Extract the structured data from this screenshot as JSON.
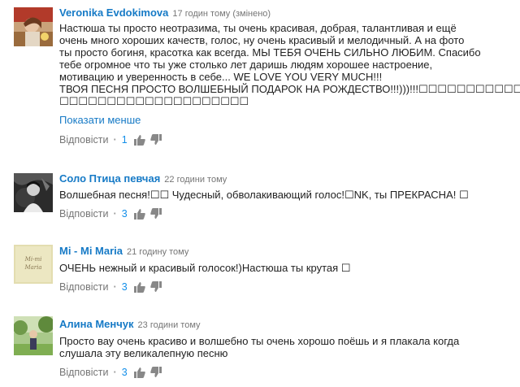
{
  "comments": [
    {
      "author": "Veronika Evdokimova",
      "time": "17 годин тому (змінено)",
      "lines": [
        "Настюша ты просто неотразима, ты очень красивая, добрая, талантливая и ещё",
        "очень много хороших качеств, голос, ну очень красивый и мелодичный. А на фото",
        "ты просто богиня, красотка как всегда. МЫ ТЕБЯ ОЧЕНЬ СИЛЬНО ЛЮБИМ. Спасибо",
        "тебе огромное что ты уже столько лет даришь людям хорошее настроение,",
        "мотивацию и уверенность в себе... WE LOVE YOU VERY MUCH!!!",
        "ТВОЯ ПЕСНЯ ПРОСТО ВОЛШЕБНЫЙ ПОДАРОК НА РОЖДЕСТВО!!!)))!!!☐☐☐☐☐☐☐☐☐☐☐☐",
        "☐☐☐☐☐☐☐☐☐☐☐☐☐☐☐☐☐☐☐☐"
      ],
      "show_less": "Показати менше",
      "reply": "Відповісти",
      "likes": "1"
    },
    {
      "author": "Соло Птица певчая",
      "time": "22 години тому",
      "lines": [
        "Волшебная песня!☐☐ Чудесный, обволакивающий голос!☐NK, ты ПРЕКРАСНА! ☐"
      ],
      "reply": "Відповісти",
      "likes": "3"
    },
    {
      "author": "Mi - Mi Maria",
      "time": "21 годину тому",
      "lines": [
        "ОЧЕНЬ нежный и красивый голосок!)Настюша ты крутая ☐"
      ],
      "reply": "Відповісти",
      "likes": "3",
      "avatar_text": "Mi-mi Maria"
    },
    {
      "author": "Алина Менчук",
      "time": "23 години тому",
      "lines": [
        "Просто вау очень красиво и волшебно ты очень хорошо поёшь и я плакала когда",
        "слушала эту великалепную песню"
      ],
      "reply": "Відповісти",
      "likes": "3"
    }
  ]
}
